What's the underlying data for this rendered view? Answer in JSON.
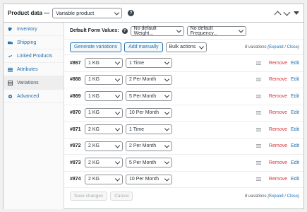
{
  "header": {
    "title": "Product data —",
    "product_type": "Variable product",
    "help": "?"
  },
  "sidebar": {
    "items": [
      {
        "label": "Inventory",
        "icon": "inventory-icon",
        "active": false
      },
      {
        "label": "Shipping",
        "icon": "truck-icon",
        "active": false
      },
      {
        "label": "Linked Products",
        "icon": "link-icon",
        "active": false
      },
      {
        "label": "Attributes",
        "icon": "list-icon",
        "active": false
      },
      {
        "label": "Variations",
        "icon": "grid-icon",
        "active": true
      },
      {
        "label": "Advanced",
        "icon": "gear-icon",
        "active": false
      }
    ]
  },
  "defaults": {
    "label": "Default Form Values:",
    "weight": "No default Weight...",
    "frequency": "No default Frequency..."
  },
  "toolbar": {
    "generate": "Generate variations",
    "add": "Add manually",
    "bulk": "Bulk actions"
  },
  "count": {
    "text": "8 variations",
    "expand": "Expand",
    "sep": " / ",
    "close": "Close"
  },
  "actions": {
    "remove": "Remove",
    "edit": "Edit"
  },
  "variations": [
    {
      "id": "#867",
      "weight": "1 KG",
      "frequency": "1 Time"
    },
    {
      "id": "#868",
      "weight": "1 KG",
      "frequency": "2 Per Month"
    },
    {
      "id": "#869",
      "weight": "1 KG",
      "frequency": "5 Per Month"
    },
    {
      "id": "#870",
      "weight": "1 KG",
      "frequency": "10 Per Month"
    },
    {
      "id": "#871",
      "weight": "2 KG",
      "frequency": "1 Time"
    },
    {
      "id": "#872",
      "weight": "2 KG",
      "frequency": "2 Per Month"
    },
    {
      "id": "#873",
      "weight": "2 KG",
      "frequency": "5 Per Month"
    },
    {
      "id": "#874",
      "weight": "2 KG",
      "frequency": "10 Per Month"
    }
  ],
  "footer": {
    "save": "Save changes",
    "cancel": "Cancel"
  }
}
